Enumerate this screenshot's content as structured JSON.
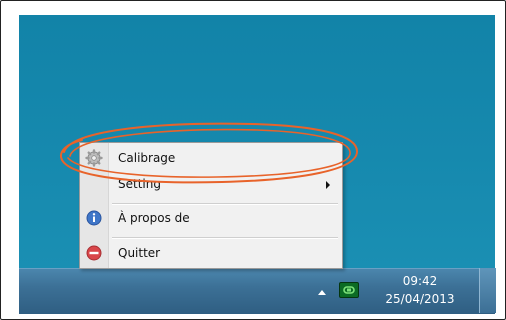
{
  "menu": {
    "items": [
      {
        "label": "Calibrage",
        "icon": "gear-icon"
      },
      {
        "label": "Setting",
        "icon": "",
        "has_submenu": true
      },
      {
        "label": "À propos de",
        "icon": "info-icon"
      },
      {
        "label": "Quitter",
        "icon": "quit-icon"
      }
    ]
  },
  "taskbar": {
    "tray_icon": "tray-app-icon",
    "clock": {
      "time": "09:42",
      "date": "25/04/2013"
    }
  },
  "colors": {
    "desktop": "#1689ae",
    "taskbar": "#3c7096",
    "highlight_ellipse": "#e8632a",
    "info_icon": "#3f76c8",
    "quit_icon": "#d9464a",
    "tray_app": "#0b6b24"
  }
}
